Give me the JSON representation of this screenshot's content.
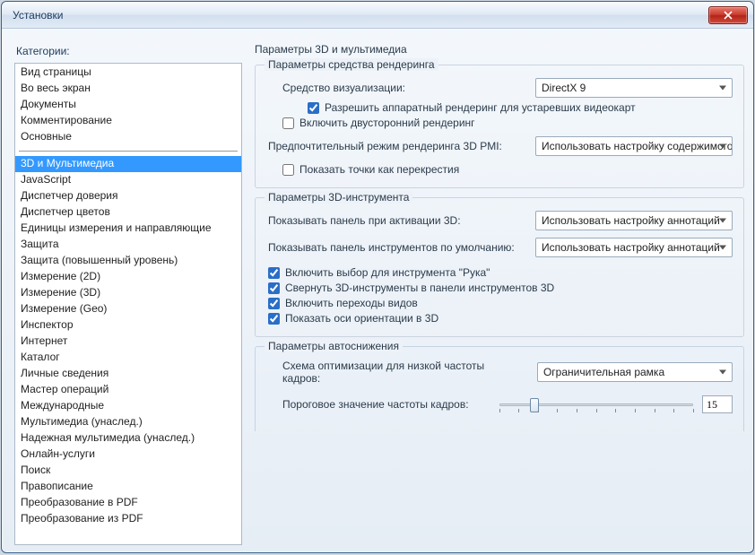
{
  "window": {
    "title": "Установки"
  },
  "left": {
    "label": "Категории:",
    "items_block1": [
      "Вид страницы",
      "Во весь экран",
      "Документы",
      "Комментирование",
      "Основные"
    ],
    "items_block2": [
      "3D и Мультимедиа",
      "JavaScript",
      "Диспетчер доверия",
      "Диспетчер цветов",
      "Единицы измерения и направляющие",
      "Защита",
      "Защита (повышенный уровень)",
      "Измерение (2D)",
      "Измерение (3D)",
      "Измерение (Geo)",
      "Инспектор",
      "Интернет",
      "Каталог",
      "Личные сведения",
      "Мастер операций",
      "Международные",
      "Мультимедиа (унаслед.)",
      "Надежная мультимедиа (унаслед.)",
      "Онлайн-услуги",
      "Поиск",
      "Правописание",
      "Преобразование в PDF",
      "Преобразование из PDF"
    ],
    "selected": "3D и Мультимедиа"
  },
  "right": {
    "heading": "Параметры 3D и мультимедиа",
    "rendering": {
      "title": "Параметры средства рендеринга",
      "vis_label": "Средство визуализации:",
      "vis_value": "DirectX 9",
      "allow_hw_label": "Разрешить аппаратный рендеринг для устаревших видеокарт",
      "allow_hw_checked": true,
      "double_sided_label": "Включить двусторонний рендеринг",
      "double_sided_checked": false,
      "pmi_label": "Предпочтительный режим рендеринга 3D PMI:",
      "pmi_value": "Использовать настройку содержимого",
      "crosshair_label": "Показать точки как перекрестия",
      "crosshair_checked": false
    },
    "tool": {
      "title": "Параметры 3D-инструмента",
      "panel_on_activate_label": "Показывать панель при активации 3D:",
      "panel_on_activate_value": "Использовать настройку аннотаций",
      "default_panel_label": "Показывать панель инструментов по умолчанию:",
      "default_panel_value": "Использовать настройку аннотаций",
      "hand_label": "Включить выбор для инструмента \"Рука\"",
      "hand_checked": true,
      "collapse_label": "Свернуть 3D-инструменты в панели инструментов 3D",
      "collapse_checked": true,
      "transitions_label": "Включить переходы видов",
      "transitions_checked": true,
      "axes_label": "Показать оси ориентации в 3D",
      "axes_checked": true
    },
    "auto": {
      "title": "Параметры автоснижения",
      "scheme_label": "Схема оптимизации для низкой частоты кадров:",
      "scheme_value": "Ограничительная рамка",
      "threshold_label": "Пороговое значение частоты кадров:",
      "threshold_value": "15",
      "threshold_pos": 0.18
    }
  }
}
